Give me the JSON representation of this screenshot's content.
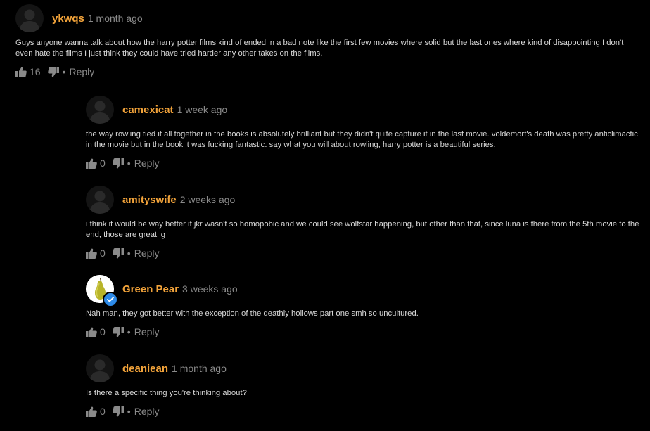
{
  "comments": [
    {
      "username": "ykwqs",
      "time": "1 month ago",
      "text": "Guys anyone wanna talk about how the harry potter films kind of ended in a bad note like the first few movies where solid but the last ones where kind of disappointing I don't even hate the films I just think they could have tried harder any other takes on the films.",
      "likes": "16",
      "reply_label": "Reply",
      "separator": "•"
    },
    {
      "username": "camexicat",
      "time": "1 week ago",
      "text": "the way rowling tied it all together in the books is absolutely brilliant but they didn't quite capture it in the last movie. voldemort's death was pretty anticlimactic in the movie but in the book it was fucking fantastic. say what you will about rowling, harry potter is a beautiful series.",
      "likes": "0",
      "reply_label": "Reply",
      "separator": "•"
    },
    {
      "username": "amityswife",
      "time": "2 weeks ago",
      "text": "i think it would be way better if jkr wasn't so homopobic and we could see wolfstar happening, but other than that, since luna is there from the 5th movie to the end, those are great ig",
      "likes": "0",
      "reply_label": "Reply",
      "separator": "•"
    },
    {
      "username": "Green Pear",
      "time": "3 weeks ago",
      "text": "Nah man, they got better with the exception of the deathly hollows part one smh so uncultured.",
      "likes": "0",
      "reply_label": "Reply",
      "separator": "•"
    },
    {
      "username": "deaniean",
      "time": "1 month ago",
      "text": "Is there a specific thing you're thinking about?",
      "likes": "0",
      "reply_label": "Reply",
      "separator": "•"
    }
  ],
  "colors": {
    "background": "#000000",
    "username": "#f2a33a",
    "meta": "#8a8a8a",
    "text": "#d8d8d8",
    "verified": "#2d8ae8"
  },
  "icons": {
    "avatar_default": "default-avatar-silhouette-icon",
    "avatar_pear": "green-pear-avatar-icon",
    "verified": "verified-check-icon",
    "like": "thumbs-up-icon",
    "dislike": "thumbs-down-icon"
  }
}
